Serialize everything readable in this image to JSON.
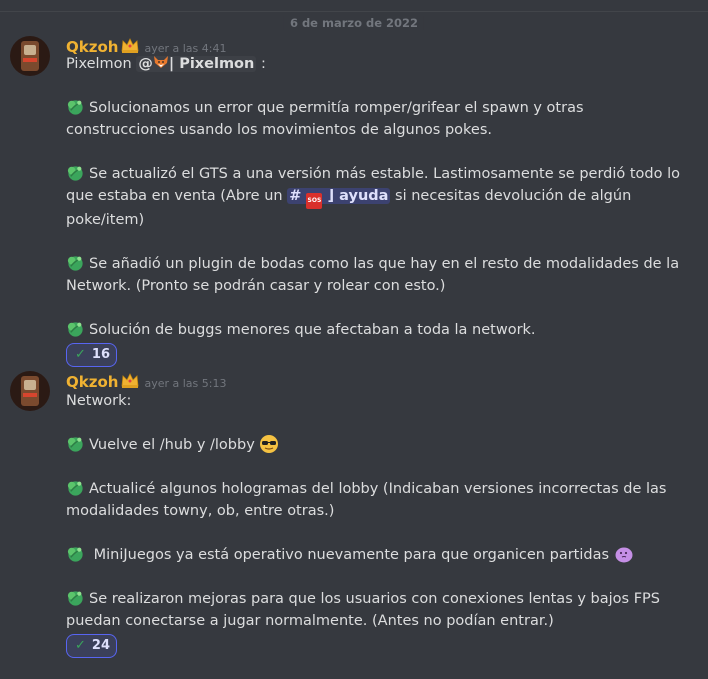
{
  "date_divider": "6 de marzo de 2022",
  "messages": [
    {
      "username": "Qkzoh",
      "timestamp": "ayer a las 4:41",
      "intro_text": "Pixelmon ",
      "intro_at": "@",
      "intro_role": "| Pixelmon",
      "intro_suffix": " :",
      "items": [
        "Solucionamos un error que permitía romper/grifear el spawn y otras construcciones usando los movimientos de algunos pokes.",
        "Se actualizó el GTS a una versión más estable. Lastimosamente se perdió todo lo que estaba en venta (Abre un ",
        "Se añadió un plugin de bodas como las que hay en el resto de modalidades de la Network. (Pronto se podrán casar y rolear con esto.)",
        "Solución de buggs menores que afectaban a toda la network."
      ],
      "channel_name": "⌋ ayuda",
      "channel_hash": "#",
      "sos_label": "SOS",
      "item2_suffix": " si necesitas devolución de algún poke/item)",
      "reaction_count": "16"
    },
    {
      "username": "Qkzoh",
      "timestamp": "ayer a las 5:13",
      "intro_text": "Network:",
      "items": [
        "Vuelve el /hub y /lobby ",
        "Actualicé algunos hologramas del lobby (Indicaban versiones incorrectas de las modalidades towny, ob, entre otras.)",
        " MiniJuegos ya está operativo nuevamente para que organicen partidas ",
        "Se realizaron mejoras para que los usuarios con conexiones lentas y bajos FPS puedan conectarse a jugar normalmente. (Antes no podían entrar.)"
      ],
      "reaction_count": "24"
    }
  ],
  "colors": {
    "background": "#36393f",
    "username": "#f0b232",
    "timestamp": "#72767d",
    "reaction_border": "#5865f2",
    "bullet_green": "#3ba55c"
  },
  "icons": [
    "crown-icon",
    "fox-icon",
    "bullet-leaf-icon",
    "sos-icon",
    "check-icon",
    "sunglasses-emoji",
    "purple-blob-emoji"
  ]
}
